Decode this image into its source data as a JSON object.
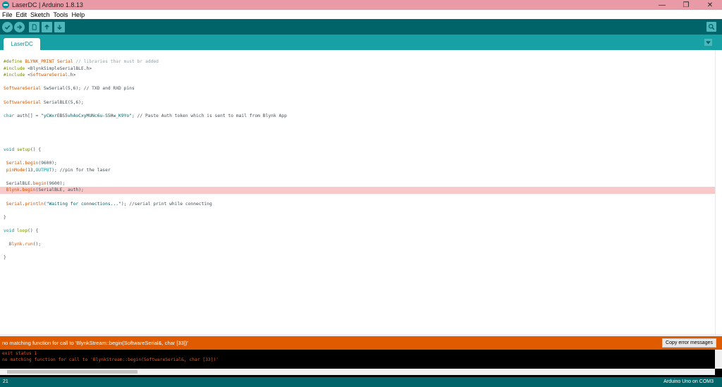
{
  "window": {
    "title": "LaserDC | Arduino 1.8.13",
    "minimize": "—",
    "maximize": "❐",
    "close": "✕"
  },
  "menu": [
    "File",
    "Edit",
    "Sketch",
    "Tools",
    "Help"
  ],
  "toolbar": {
    "icons": [
      "verify-icon",
      "upload-icon",
      "new-icon",
      "open-icon",
      "save-icon",
      "serial-monitor-icon"
    ]
  },
  "tab": {
    "label": "LaserDC"
  },
  "code": {
    "l1_a": "#define ",
    "l1_b": "BLYNK_PRINT",
    "l1_c": " ",
    "l1_d": "Serial",
    "l1_e": " // libraries thar must br added",
    "l2_a": "#include ",
    "l2_b": "<BlynkSimpleSerialBLE.h>",
    "l3_a": "#include ",
    "l3_b": "<",
    "l3_c": "SoftwareSerial",
    "l3_d": ".h>",
    "l4_a": "SoftwareSerial",
    "l4_b": " SwSerial(5,6); // TXD and RXD pins",
    "l5_a": "SoftwareSerial",
    "l5_b": " SerialBLE(5,6);",
    "l6_a": "char",
    "l6_b": " auth[] = ",
    "l6_c": "\"yCWxrEBS5vhAoCxyMUNc6u-S5Hw_K9Yo\"",
    "l6_d": "; // Paste Auth token which is sent to mail from Blynk App",
    "l7_a": "void",
    "l7_b": " ",
    "l7_c": "setup",
    "l7_d": "() {",
    "l8_a": " ",
    "l8_b": "Serial",
    "l8_c": ".",
    "l8_d": "begin",
    "l8_e": "(9600);",
    "l9_a": " ",
    "l9_b": "pinMode",
    "l9_c": "(13,",
    "l9_d": "OUTPUT",
    "l9_e": "); //pin for the laser",
    "l10_a": " SerialBLE.",
    "l10_b": "begin",
    "l10_c": "(9600);",
    "l11_a": " ",
    "l11_b": "Blynk",
    "l11_c": ".",
    "l11_d": "begin",
    "l11_e": "(SerialBLE, auth);",
    "l12_a": " ",
    "l12_b": "Serial",
    "l12_c": ".",
    "l12_d": "println",
    "l12_e": "(",
    "l12_f": "\"Waiting for connections...\"",
    "l12_g": "); //serial print while connecting",
    "l13": "}",
    "l14_a": "void",
    "l14_b": " ",
    "l14_c": "loop",
    "l14_d": "() {",
    "l15_a": "  ",
    "l15_b": "Blynk",
    "l15_c": ".",
    "l15_d": "run",
    "l15_e": "();",
    "l16": "}"
  },
  "error": {
    "message": "no matching function for call to 'BlynkStream::begin(SoftwareSerial&, char [33])'",
    "copy_button": "Copy error messages"
  },
  "console": {
    "line1": "exit status 1",
    "line2": "no matching function for call to 'BlynkStream::begin(SoftwareSerial&, char [33])'"
  },
  "status": {
    "line_number": "21",
    "board": "Arduino Uno on COM3"
  },
  "colors": {
    "toolbar": "#006468",
    "tabbar": "#17a1a5",
    "error": "#e05a00",
    "highlight": "#f9c9c9",
    "titlebar": "#e89aa6"
  }
}
